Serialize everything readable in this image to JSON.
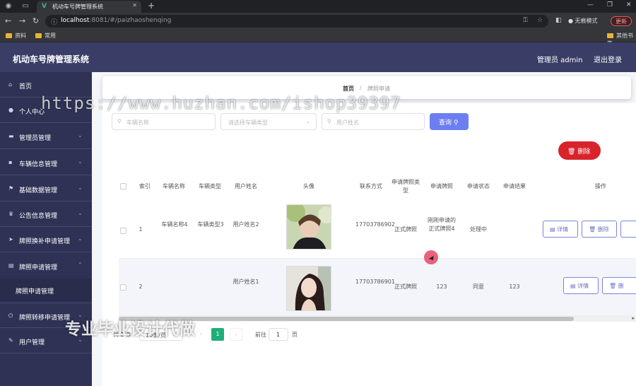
{
  "browser": {
    "tab_title": "机动车号牌管理系统",
    "url_host": "localhost",
    "url_path": ":8081/#/paizhaoshenqing",
    "incognito_label": "无痕模式",
    "update_label": "更新",
    "bookmarks": [
      "资料",
      "常用"
    ],
    "bookmarks_right": "其他书签"
  },
  "app": {
    "title": "机动车号牌管理系统",
    "admin_label": "管理员 admin",
    "logout_label": "退出登录"
  },
  "sidebar": {
    "items": [
      {
        "label": "首页",
        "icon": "home-icon"
      },
      {
        "label": "个人中心",
        "icon": "user-icon"
      },
      {
        "label": "管理员管理",
        "icon": "monitor-icon"
      },
      {
        "label": "车辆信息管理",
        "icon": "chat-icon"
      },
      {
        "label": "基础数据管理",
        "icon": "flag-icon"
      },
      {
        "label": "公告信息管理",
        "icon": "trophy-icon"
      },
      {
        "label": "牌照换补申请管理",
        "icon": "send-icon"
      },
      {
        "label": "牌照申请管理",
        "icon": "document-icon"
      },
      {
        "label": "牌照转移申请管理",
        "icon": "power-icon"
      },
      {
        "label": "用户管理",
        "icon": "edit-icon"
      }
    ],
    "subitem": "牌照申请管理"
  },
  "breadcrumb": {
    "home": "首页",
    "separator": "/",
    "current": "牌照申请"
  },
  "search": {
    "vehicle_name_placeholder": "车辆名称",
    "vehicle_type_placeholder": "请选择车辆类型",
    "user_name_placeholder": "用户姓名",
    "search_button": "查询"
  },
  "delete_button": "删除",
  "table": {
    "headers": [
      "索引",
      "车辆名称",
      "车辆类型",
      "用户姓名",
      "头像",
      "联系方式",
      "申请牌照类型",
      "申请牌照",
      "申请状态",
      "申请结果",
      "操作"
    ],
    "rows": [
      {
        "index": "1",
        "vehicle_name": "车辆名称4",
        "vehicle_type": "车辆类型3",
        "user_name": "用户姓名2",
        "phone": "17703786902",
        "plate_type": "正式牌照",
        "plate": "刚刚申请的正式牌照4",
        "status": "处理中",
        "result": "",
        "detail_btn": "详情",
        "delete_btn": "删除"
      },
      {
        "index": "2",
        "vehicle_name": "",
        "vehicle_type": "",
        "user_name": "用户姓名1",
        "phone": "17703786901",
        "plate_type": "正式牌照",
        "plate": "123",
        "status": "同意",
        "result": "123",
        "detail_btn": "详情",
        "delete_btn": "删"
      }
    ]
  },
  "pagination": {
    "total": "共 2 条",
    "page_size": "10条/页",
    "current_page": "1",
    "goto_label": "前往",
    "goto_value": "1",
    "page_unit": "页"
  },
  "watermarks": {
    "url_text": "https://www.huzhan.com/ishop39397",
    "brand_text": "专业毕业设计代做"
  }
}
